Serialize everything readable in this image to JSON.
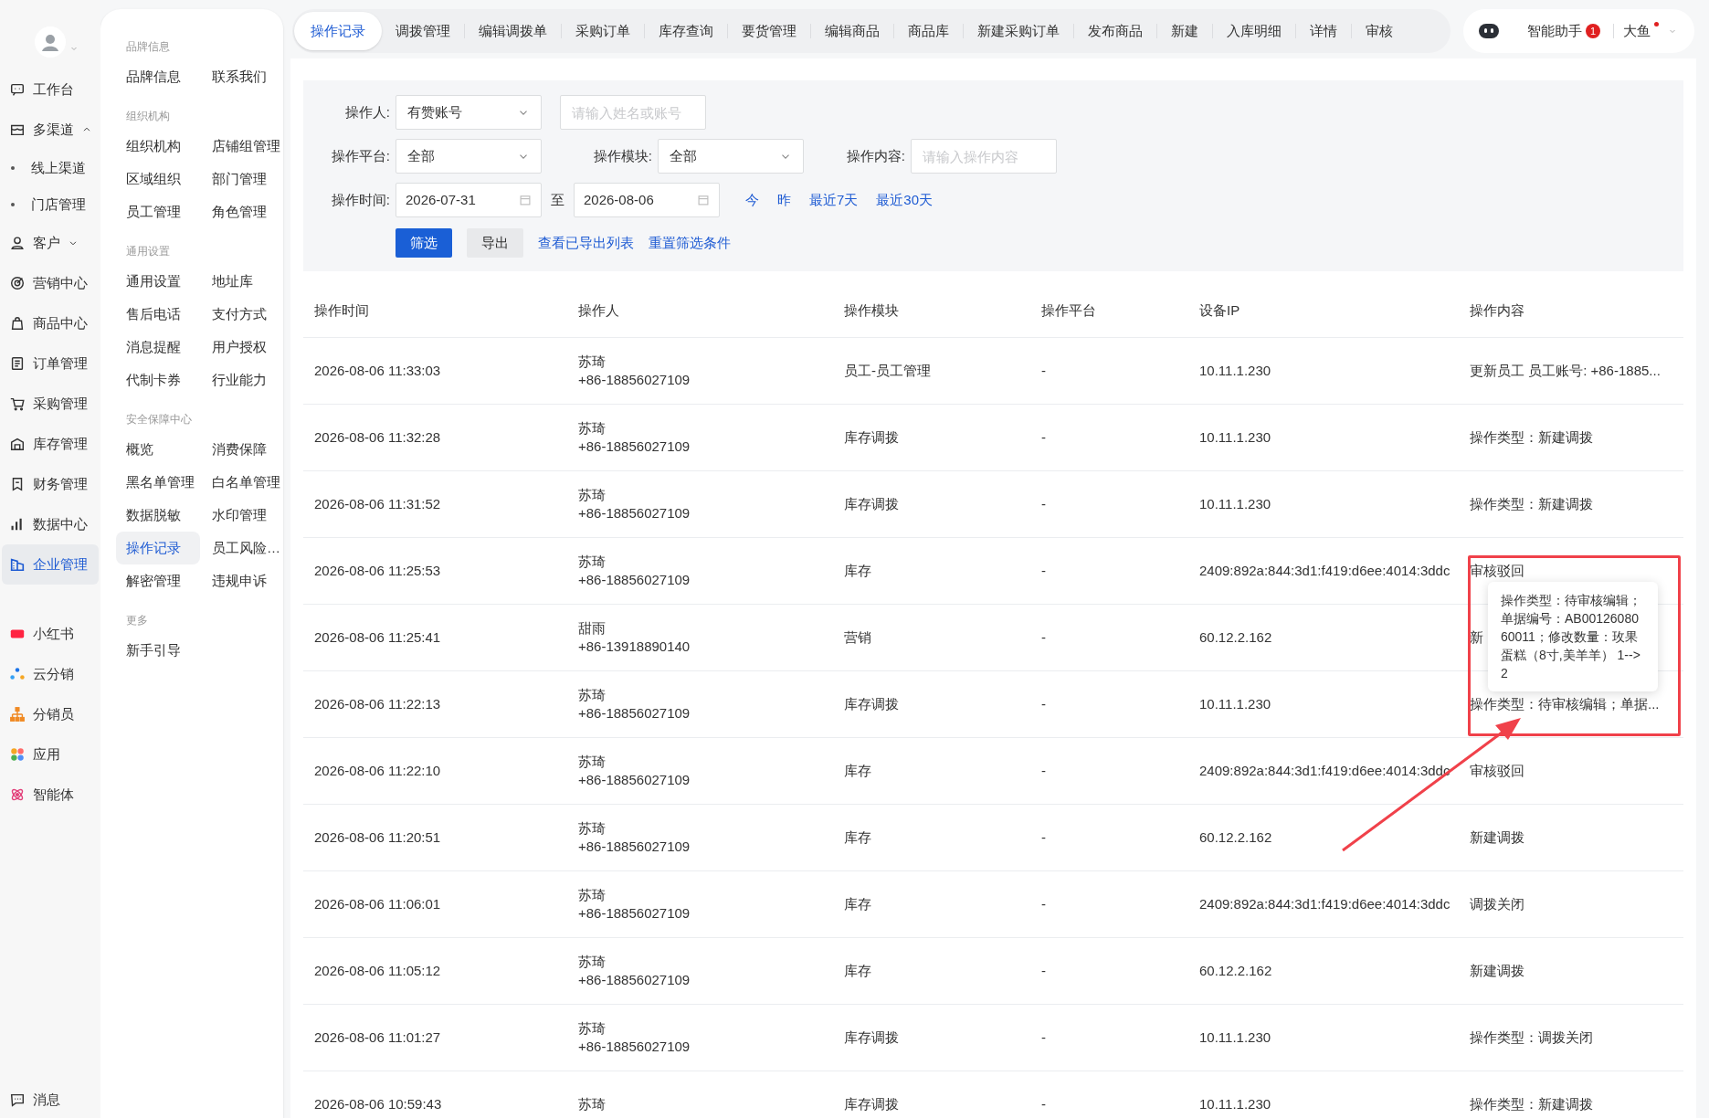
{
  "nav": {
    "main": [
      {
        "label": "工作台",
        "selected": false
      },
      {
        "label": "多渠道",
        "selected": false,
        "expanded": true,
        "children": [
          {
            "label": "线上渠道",
            "selected": false
          },
          {
            "label": "门店管理",
            "selected": false
          }
        ]
      },
      {
        "label": "客户",
        "selected": false,
        "expanded": false
      },
      {
        "label": "营销中心",
        "selected": false
      },
      {
        "label": "商品中心",
        "selected": false
      },
      {
        "label": "订单管理",
        "selected": false
      },
      {
        "label": "采购管理",
        "selected": false
      },
      {
        "label": "库存管理",
        "selected": false
      },
      {
        "label": "财务管理",
        "selected": false
      },
      {
        "label": "数据中心",
        "selected": false
      },
      {
        "label": "企业管理",
        "selected": true
      }
    ],
    "apps": [
      {
        "label": "小红书"
      },
      {
        "label": "云分销"
      },
      {
        "label": "分销员"
      },
      {
        "label": "应用"
      },
      {
        "label": "智能体"
      }
    ],
    "footer": {
      "label": "消息"
    }
  },
  "submenu": [
    {
      "title": "品牌信息",
      "items": [
        {
          "label": "品牌信息",
          "selected": false
        },
        {
          "label": "联系我们",
          "selected": false
        }
      ]
    },
    {
      "title": "组织机构",
      "items": [
        {
          "label": "组织机构",
          "selected": false
        },
        {
          "label": "店铺组管理",
          "selected": false
        },
        {
          "label": "区域组织",
          "selected": false
        },
        {
          "label": "部门管理",
          "selected": false
        },
        {
          "label": "员工管理",
          "selected": false
        },
        {
          "label": "角色管理",
          "selected": false
        }
      ]
    },
    {
      "title": "通用设置",
      "items": [
        {
          "label": "通用设置",
          "selected": false
        },
        {
          "label": "地址库",
          "selected": false
        },
        {
          "label": "售后电话",
          "selected": false
        },
        {
          "label": "支付方式",
          "selected": false
        },
        {
          "label": "消息提醒",
          "selected": false
        },
        {
          "label": "用户授权",
          "selected": false
        },
        {
          "label": "代制卡券",
          "selected": false
        },
        {
          "label": "行业能力",
          "selected": false
        }
      ]
    },
    {
      "title": "安全保障中心",
      "items": [
        {
          "label": "概览",
          "selected": false
        },
        {
          "label": "消费保障",
          "selected": false
        },
        {
          "label": "黑名单管理",
          "selected": false
        },
        {
          "label": "白名单管理",
          "selected": false
        },
        {
          "label": "数据脱敏",
          "selected": false
        },
        {
          "label": "水印管理",
          "selected": false
        },
        {
          "label": "操作记录",
          "selected": true
        },
        {
          "label": "员工风险…",
          "selected": false
        },
        {
          "label": "解密管理",
          "selected": false
        },
        {
          "label": "违规申诉",
          "selected": false
        }
      ]
    },
    {
      "title": "更多",
      "items": [
        {
          "label": "新手引导",
          "selected": false
        }
      ]
    }
  ],
  "tabs": [
    {
      "label": "操作记录",
      "selected": true
    },
    {
      "label": "调拨管理",
      "selected": false
    },
    {
      "label": "编辑调拨单",
      "selected": false
    },
    {
      "label": "采购订单",
      "selected": false
    },
    {
      "label": "库存查询",
      "selected": false
    },
    {
      "label": "要货管理",
      "selected": false
    },
    {
      "label": "编辑商品",
      "selected": false
    },
    {
      "label": "商品库",
      "selected": false
    },
    {
      "label": "新建采购订单",
      "selected": false
    },
    {
      "label": "发布商品",
      "selected": false
    },
    {
      "label": "新建",
      "selected": false
    },
    {
      "label": "入库明细",
      "selected": false
    },
    {
      "label": "详情",
      "selected": false
    },
    {
      "label": "审核",
      "selected": false
    }
  ],
  "header": {
    "assistant": "智能助手",
    "badge": "1",
    "user": "大鱼"
  },
  "filters": {
    "operator_label": "操作人:",
    "operator_type": "有赞账号",
    "operator_placeholder": "请输入姓名或账号",
    "platform_label": "操作平台:",
    "platform": "全部",
    "module_label": "操作模块:",
    "module": "全部",
    "content_label": "操作内容:",
    "content_placeholder": "请输入操作内容",
    "time_label": "操作时间:",
    "start_date": "2026-07-31",
    "to": "至",
    "end_date": "2026-08-06",
    "quick_ranges": [
      "今",
      "昨",
      "最近7天",
      "最近30天"
    ],
    "buttons": [
      {
        "label": "筛选",
        "kind": "primary"
      },
      {
        "label": "导出",
        "kind": "secondary"
      }
    ],
    "links": [
      "查看已导出列表",
      "重置筛选条件"
    ]
  },
  "table": {
    "columns": [
      "操作时间",
      "操作人",
      "操作模块",
      "操作平台",
      "设备IP",
      "操作内容"
    ],
    "rows": [
      {
        "time": "2026-08-06 11:33:03",
        "operator": "苏琦",
        "phone": "+86-18856027109",
        "module": "员工-员工管理",
        "platform": "-",
        "ip": "10.11.1.230",
        "content": "更新员工 员工账号: +86-1885..."
      },
      {
        "time": "2026-08-06 11:32:28",
        "operator": "苏琦",
        "phone": "+86-18856027109",
        "module": "库存调拨",
        "platform": "-",
        "ip": "10.11.1.230",
        "content": "操作类型：新建调拨"
      },
      {
        "time": "2026-08-06 11:31:52",
        "operator": "苏琦",
        "phone": "+86-18856027109",
        "module": "库存调拨",
        "platform": "-",
        "ip": "10.11.1.230",
        "content": "操作类型：新建调拨"
      },
      {
        "time": "2026-08-06 11:25:53",
        "operator": "苏琦",
        "phone": "+86-18856027109",
        "module": "库存",
        "platform": "-",
        "ip": "2409:892a:844:3d1:f419:d6ee:4014:3ddc",
        "content": "审核驳回"
      },
      {
        "time": "2026-08-06 11:25:41",
        "operator": "甜雨",
        "phone": "+86-13918890140",
        "module": "营销",
        "platform": "-",
        "ip": "60.12.2.162",
        "content": "新"
      },
      {
        "time": "2026-08-06 11:22:13",
        "operator": "苏琦",
        "phone": "+86-18856027109",
        "module": "库存调拨",
        "platform": "-",
        "ip": "10.11.1.230",
        "content": "操作类型：待审核编辑；单据..."
      },
      {
        "time": "2026-08-06 11:22:10",
        "operator": "苏琦",
        "phone": "+86-18856027109",
        "module": "库存",
        "platform": "-",
        "ip": "2409:892a:844:3d1:f419:d6ee:4014:3ddc",
        "content": "审核驳回"
      },
      {
        "time": "2026-08-06 11:20:51",
        "operator": "苏琦",
        "phone": "+86-18856027109",
        "module": "库存",
        "platform": "-",
        "ip": "60.12.2.162",
        "content": "新建调拨"
      },
      {
        "time": "2026-08-06 11:06:01",
        "operator": "苏琦",
        "phone": "+86-18856027109",
        "module": "库存",
        "platform": "-",
        "ip": "2409:892a:844:3d1:f419:d6ee:4014:3ddc",
        "content": "调拨关闭"
      },
      {
        "time": "2026-08-06 11:05:12",
        "operator": "苏琦",
        "phone": "+86-18856027109",
        "module": "库存",
        "platform": "-",
        "ip": "60.12.2.162",
        "content": "新建调拨"
      },
      {
        "time": "2026-08-06 11:01:27",
        "operator": "苏琦",
        "phone": "+86-18856027109",
        "module": "库存调拨",
        "platform": "-",
        "ip": "10.11.1.230",
        "content": "操作类型：调拨关闭"
      },
      {
        "time": "2026-08-06 10:59:43",
        "operator": "苏琦",
        "module": "库存调拨",
        "platform": "-",
        "ip": "10.11.1.230",
        "content": "操作类型：新建调拨"
      }
    ]
  },
  "tooltip": "操作类型：待审核编辑；单据编号：AB0012608060011；修改数量：玫果蛋糕（8寸,美羊羊） 1-->2"
}
